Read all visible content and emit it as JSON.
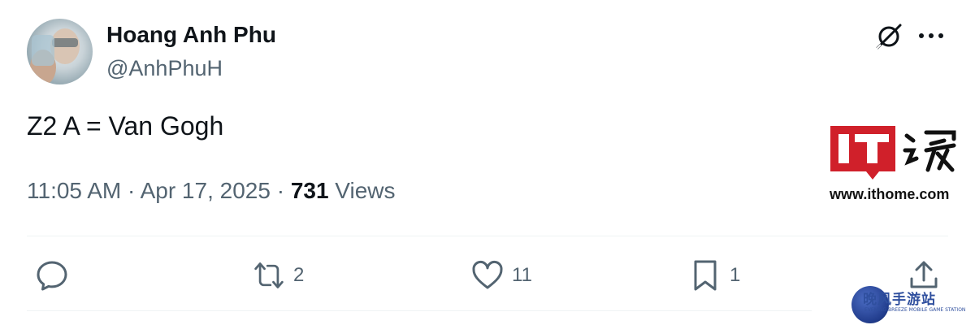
{
  "author": {
    "name": "Hoang Anh Phu",
    "handle": "@AnhPhuH"
  },
  "tweet": {
    "text": "Z2 A = Van Gogh"
  },
  "meta": {
    "time": "11:05 AM",
    "separator1": " · ",
    "date": "Apr 17, 2025",
    "separator2": " · ",
    "views_count": "731",
    "views_label": " Views"
  },
  "actions": {
    "reply_count": "",
    "retweet_count": "2",
    "like_count": "11",
    "bookmark_count": "1"
  },
  "icons": {
    "top_right": [
      "grok-icon",
      "more-icon"
    ],
    "actions": [
      "reply-icon",
      "retweet-icon",
      "like-icon",
      "bookmark-icon",
      "share-icon"
    ]
  },
  "watermark": {
    "logo_text": "IT之家",
    "url": "www.ithome.com",
    "bottom_text": "晚风手游站",
    "bottom_sub": "EVENING BREEZE MOBILE GAME STATION"
  },
  "colors": {
    "text_primary": "#0f1419",
    "text_secondary": "#536471",
    "divider": "#eff3f4",
    "logo_red": "#d0202a"
  }
}
